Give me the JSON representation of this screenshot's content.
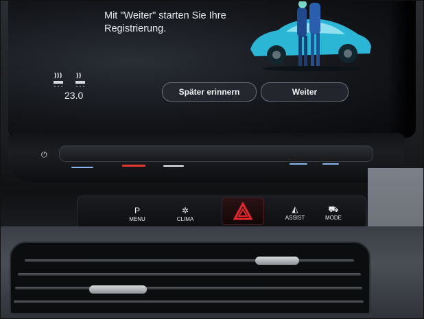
{
  "screen": {
    "message_lines": [
      "Mit \"Weiter\" starten Sie Ihre",
      "Registrierung."
    ],
    "temperature": "23.0",
    "buttons": {
      "later": "Später erinnern",
      "next": "Weiter"
    }
  },
  "console_keys": [
    {
      "icon": "P",
      "label": "MENU"
    },
    {
      "icon": "✲",
      "label": "CLIMA"
    },
    {
      "icon": "◭",
      "label": "ASSIST"
    },
    {
      "icon": "⛟",
      "label": "MODE"
    }
  ],
  "icons": [
    "seat-heat-icon",
    "power-icon",
    "hazard-icon",
    "car-illustration"
  ],
  "colors": {
    "hazard_red": "#e8262b",
    "led_blue": "#8ab8f0",
    "led_red": "#e23a2c",
    "led_white": "#f2f4f6",
    "car_teal": "#2bb6d6"
  }
}
